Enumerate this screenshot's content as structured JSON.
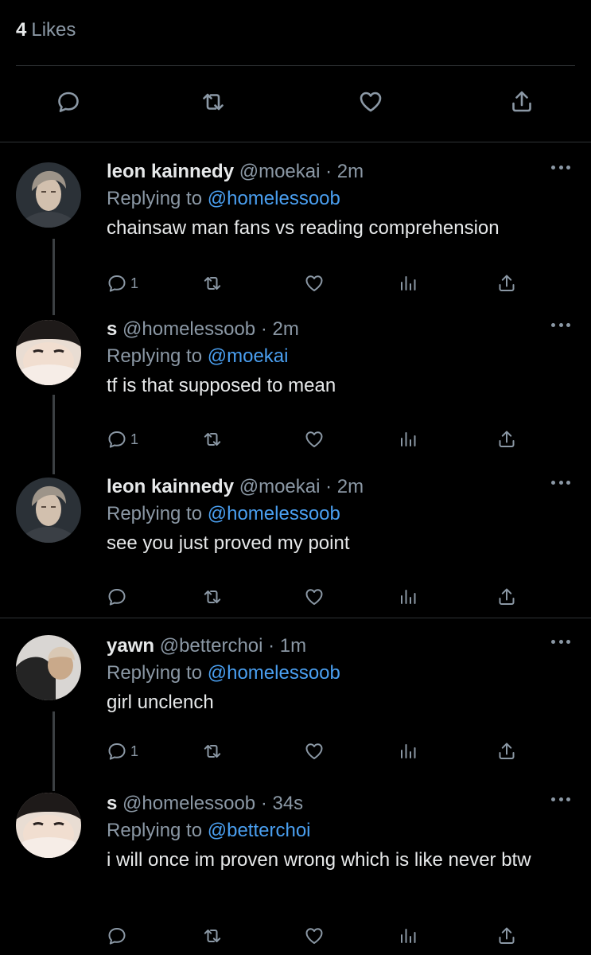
{
  "header": {
    "likes_count": "4",
    "likes_label": "Likes"
  },
  "main_actions": {
    "icons": [
      "reply-icon",
      "retweet-icon",
      "like-icon",
      "share-icon"
    ]
  },
  "tweets": [
    {
      "name": "leon kainnedy",
      "handle": "@moekai",
      "time": "2m",
      "replying_label": "Replying to",
      "replying_to": "@homelessoob",
      "text": "chainsaw man fans vs reading comprehension",
      "reply_count": "1"
    },
    {
      "name": "s",
      "handle": "@homelessoob",
      "time": "2m",
      "replying_label": "Replying to",
      "replying_to": "@moekai",
      "text": "tf is that supposed to mean",
      "reply_count": "1"
    },
    {
      "name": "leon kainnedy",
      "handle": "@moekai",
      "time": "2m",
      "replying_label": "Replying to",
      "replying_to": "@homelessoob",
      "text": "see you just proved my point",
      "reply_count": ""
    },
    {
      "name": "yawn",
      "handle": "@betterchoi",
      "time": "1m",
      "replying_label": "Replying to",
      "replying_to": "@homelessoob",
      "text": "girl unclench",
      "reply_count": "1"
    },
    {
      "name": "s",
      "handle": "@homelessoob",
      "time": "34s",
      "replying_label": "Replying to",
      "replying_to": "@betterchoi",
      "text": "i will once im proven wrong which is like never btw",
      "reply_count": ""
    }
  ],
  "colors": {
    "background": "#000000",
    "text": "#e7e9ea",
    "muted": "#8b98a5",
    "mention": "#4a9ff0",
    "divider": "#2f3336"
  }
}
